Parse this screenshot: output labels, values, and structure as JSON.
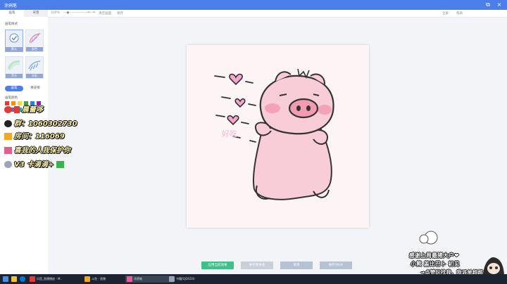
{
  "window": {
    "title": "涂鸦笔"
  },
  "left_tabs": [
    "画笔",
    "背景"
  ],
  "left": {
    "section_title": "画笔样式",
    "brushes": [
      {
        "label": "默认",
        "selected": true
      },
      {
        "label": "彩色",
        "selected": false
      },
      {
        "label": "荧光",
        "selected": false
      },
      {
        "label": "水彩",
        "selected": false
      }
    ],
    "modes": [
      "画笔",
      "橡皮擦"
    ],
    "color_label": "画笔颜色",
    "swatches": [
      "#e53935",
      "#fb8c00",
      "#fdd835",
      "#43a047",
      "#1e88e5",
      "#8e24aa",
      "#ec407a",
      "#5c6bc0",
      "#26a69a",
      "#f06292",
      "#90a4ae",
      "#212121"
    ]
  },
  "toolbar": {
    "zoom": "100%",
    "undo_label": "↶",
    "redo_label": "↷",
    "clear_label": "清空画面",
    "save_label": "保存",
    "right_label": "全屏",
    "right2_label": "帮助"
  },
  "actions": [
    {
      "label": "应用当前效果",
      "color": "#3fbf8a"
    },
    {
      "label": "保存到本地",
      "color": "#c9cfd8"
    },
    {
      "label": "取消",
      "color": "#b6c2d4"
    },
    {
      "label": "保存为GIF",
      "color": "#b6c2d4"
    }
  ],
  "overlay": {
    "weibo": "晨蕾哆",
    "qq": "群：1060302730",
    "douyu": "房间：116069",
    "guard": "喜我的人我保护你",
    "wechat": "V3  卡滴滴+"
  },
  "doodle_text": "好吃",
  "overlay_right": {
    "line1": "感谢上周最猪大户❤",
    "line2": "小熊  盖比巴卜  初见",
    "line3": "→点赞玩找我，我派单超超"
  },
  "taskbar": {
    "items": [
      {
        "label": "抖音_直播播放 - M..",
        "active": false
      },
      {
        "label": "斗鱼 - 直播",
        "active": false
      },
      {
        "label": "涂鸦笔",
        "active": true
      },
      {
        "label": "书籍(UJOG50)",
        "active": false
      }
    ]
  }
}
